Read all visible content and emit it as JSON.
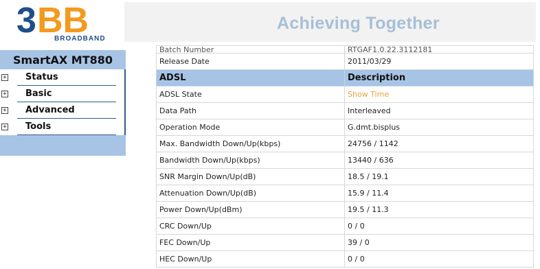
{
  "header": {
    "logo_text": "3BB",
    "logo_sub": "BROADBAND",
    "tagline": "Achieving Together",
    "colors": {
      "logo_blue": "#1f4e8c",
      "logo_orange": "#f39a1e",
      "tagline": "#a7bfd7"
    }
  },
  "sidebar": {
    "title": "SmartAX MT880",
    "items": [
      {
        "label": "Status",
        "icon": "plus-box-icon"
      },
      {
        "label": "Basic",
        "icon": "plus-box-icon"
      },
      {
        "label": "Advanced",
        "icon": "plus-box-icon"
      },
      {
        "label": "Tools",
        "icon": "plus-box-icon"
      }
    ]
  },
  "table": {
    "top_cut": {
      "label": "Batch Number",
      "value": "RTGAF1.0.22.3112181"
    },
    "release": {
      "label": "Release Date",
      "value": "2011/03/29"
    },
    "section_header": {
      "col1": "ADSL",
      "col2": "Description"
    },
    "rows": [
      {
        "label": "ADSL State",
        "value": "Show Time"
      },
      {
        "label": "Data Path",
        "value": "Interleaved"
      },
      {
        "label": "Operation Mode",
        "value": "G.dmt.bisplus"
      },
      {
        "label": "Max. Bandwidth Down/Up(kbps)",
        "value": "24756 / 1142"
      },
      {
        "label": "Bandwidth Down/Up(kbps)",
        "value": "13440 / 636"
      },
      {
        "label": "SNR Margin Down/Up(dB)",
        "value": "18.5 / 19.1"
      },
      {
        "label": "Attenuation Down/Up(dB)",
        "value": "15.9 / 11.4"
      },
      {
        "label": "Power Down/Up(dBm)",
        "value": "19.5 / 11.3"
      },
      {
        "label": "CRC Down/Up",
        "value": "0 / 0"
      },
      {
        "label": "FEC  Down/Up",
        "value": "39 / 0"
      },
      {
        "label": "HEC Down/Up",
        "value": "0 / 0"
      }
    ],
    "colors": {
      "header_bg": "#a7c4e5",
      "state_value": "#e8a23c"
    }
  }
}
